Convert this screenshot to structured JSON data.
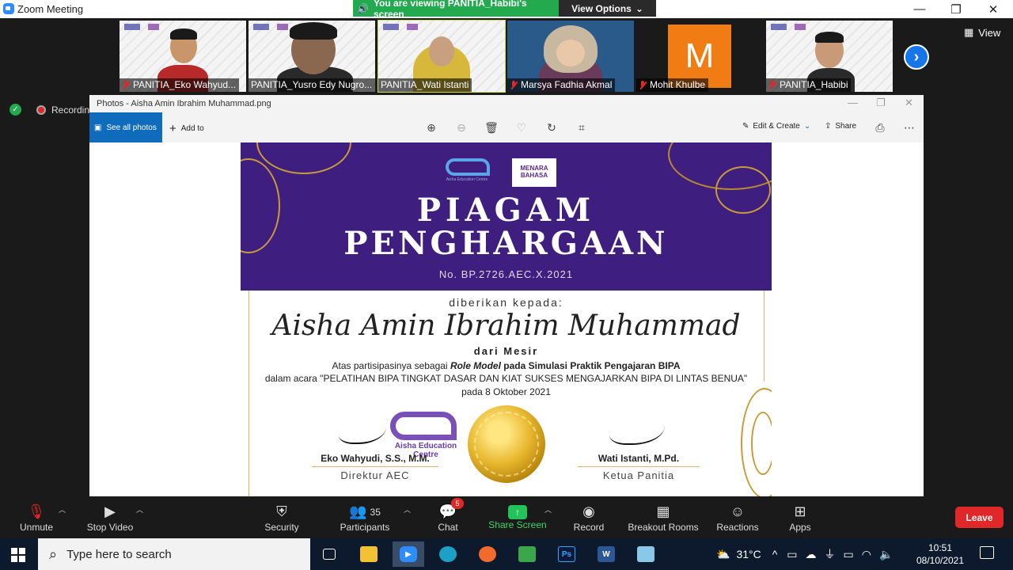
{
  "window": {
    "title": "Zoom Meeting"
  },
  "share_banner": {
    "text": "You are viewing PANITIA_Habibi's screen",
    "view_options": "View Options"
  },
  "participants_strip": [
    {
      "name": "PANITIA_Eko Wahyud...",
      "muted": true
    },
    {
      "name": "PANITIA_Yusro Edy Nugro...",
      "muted": false
    },
    {
      "name": "PANITIA_Wati Istanti",
      "muted": false,
      "active": true
    },
    {
      "name": "Marsya Fadhia Akmal",
      "muted": true
    },
    {
      "name": "Mohit Khulbe",
      "muted": true,
      "avatar_letter": "M",
      "avatar_color": "#f27c14"
    },
    {
      "name": "PANITIA_Habibi",
      "muted": true
    }
  ],
  "view_button": "View",
  "recording": {
    "label": "Recording"
  },
  "photos": {
    "title": "Photos - Aisha Amin Ibrahim Muhammad.png",
    "see_all": "See all photos",
    "add_to": "Add to",
    "edit_create": "Edit & Create",
    "share": "Share"
  },
  "certificate": {
    "logo_aec_text": "Aisha Education Centre",
    "logo_mb_text": "MENARA BAHASA",
    "title_line1": "PIAGAM",
    "title_line2": "PENGHARGAAN",
    "number": "No. BP.2726.AEC.X.2021",
    "given_to": "diberikan kepada:",
    "recipient": "Aisha Amin Ibrahim Muhammad",
    "origin": "dari Mesir",
    "line1_prefix": "Atas partisipasinya sebagai ",
    "line1_role": "Role Model",
    "line1_suffix": " pada Simulasi Praktik Pengajaran BIPA",
    "line2": "dalam acara \"PELATIHAN BIPA TINGKAT DASAR DAN KIAT SUKSES MENGAJARKAN BIPA DI LINTAS BENUA\"",
    "line3": "pada 8 Oktober 2021",
    "signer1_name": "Eko Wahyudi, S.S., M.M.",
    "signer1_role": "Direktur AEC",
    "signer2_name": "Wati Istanti, M.Pd.",
    "signer2_role": "Ketua Panitia",
    "watermark_text": "Aisha Education Centre"
  },
  "toolbar": {
    "unmute": "Unmute",
    "stop_video": "Stop Video",
    "security": "Security",
    "participants": "Participants",
    "participants_count": "35",
    "chat": "Chat",
    "chat_badge": "5",
    "share_screen": "Share Screen",
    "record": "Record",
    "breakout": "Breakout Rooms",
    "reactions": "Reactions",
    "apps": "Apps",
    "leave": "Leave"
  },
  "taskbar": {
    "search_placeholder": "Type here to search",
    "weather": "31°C",
    "time": "10:51",
    "date": "08/10/2021"
  }
}
